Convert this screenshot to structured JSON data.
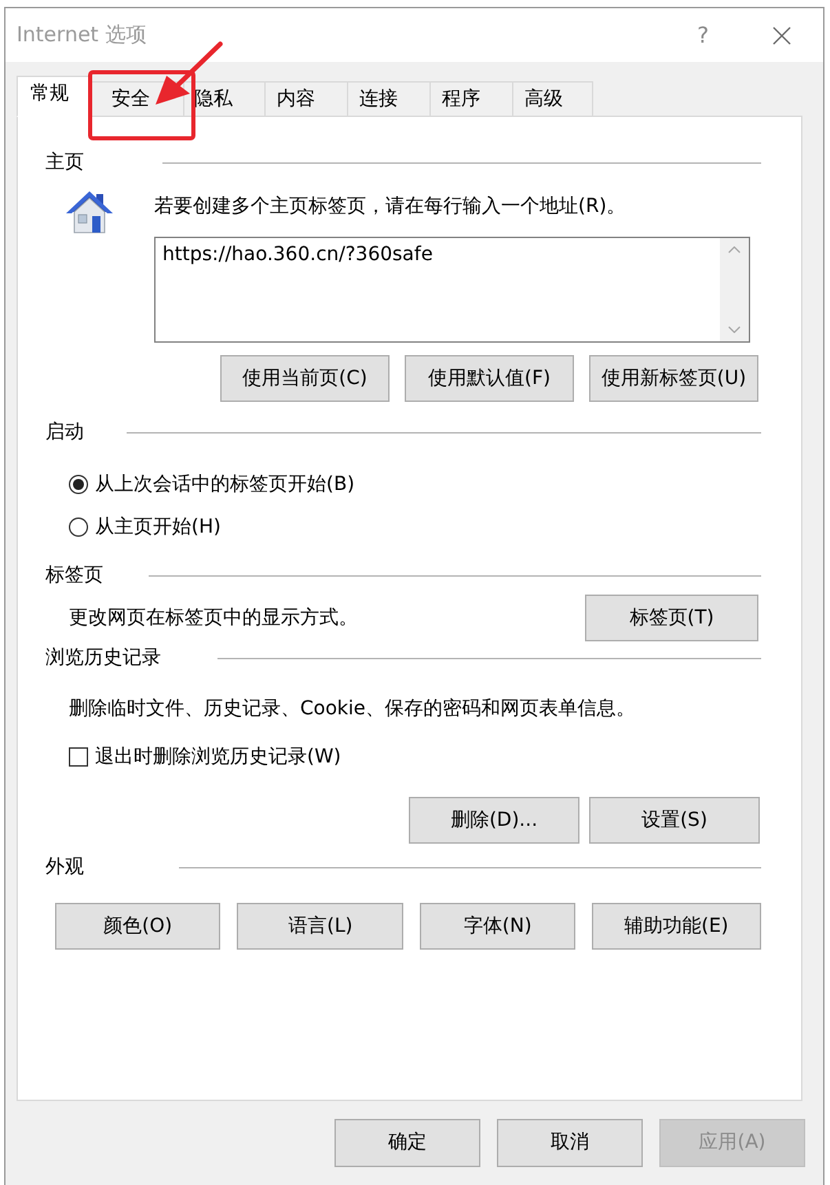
{
  "window": {
    "title": "Internet 选项",
    "help_button": "?"
  },
  "tabs": [
    {
      "label": "常规",
      "selected": true
    },
    {
      "label": "安全",
      "selected": false
    },
    {
      "label": "隐私",
      "selected": false
    },
    {
      "label": "内容",
      "selected": false
    },
    {
      "label": "连接",
      "selected": false
    },
    {
      "label": "程序",
      "selected": false
    },
    {
      "label": "高级",
      "selected": false
    }
  ],
  "home_page": {
    "heading": "主页",
    "instruction": "若要创建多个主页标签页，请在每行输入一个地址(R)。",
    "addresses": "https://hao.360.cn/?360safe",
    "buttons": [
      "使用当前页(C)",
      "使用默认值(F)",
      "使用新标签页(U)"
    ]
  },
  "startup": {
    "heading": "启动",
    "options": [
      {
        "label": "从上次会话中的标签页开始(B)",
        "selected": true
      },
      {
        "label": "从主页开始(H)",
        "selected": false
      }
    ]
  },
  "tabs_section": {
    "heading": "标签页",
    "description": "更改网页在标签页中的显示方式。",
    "button": "标签页(T)"
  },
  "browsing_history": {
    "heading": "浏览历史记录",
    "description": "删除临时文件、历史记录、Cookie、保存的密码和网页表单信息。",
    "checkbox": {
      "label": "退出时删除浏览历史记录(W)",
      "checked": false
    },
    "buttons": [
      "删除(D)...",
      "设置(S)"
    ]
  },
  "appearance": {
    "heading": "外观",
    "buttons": [
      "颜色(O)",
      "语言(L)",
      "字体(N)",
      "辅助功能(E)"
    ]
  },
  "dialog_buttons": [
    {
      "label": "确定",
      "disabled": false
    },
    {
      "label": "取消",
      "disabled": false
    },
    {
      "label": "应用(A)",
      "disabled": true
    }
  ]
}
